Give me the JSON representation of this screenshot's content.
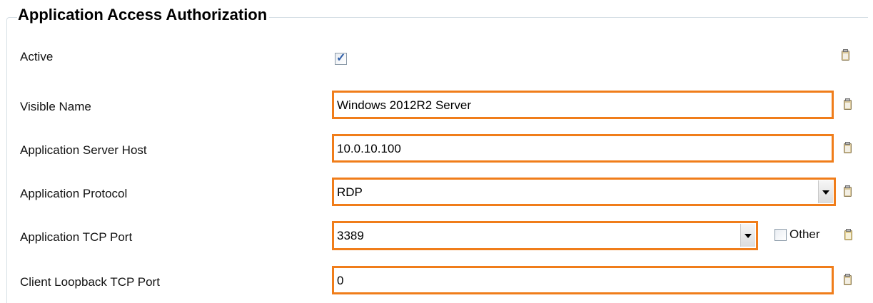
{
  "section": {
    "title": "Application Access Authorization"
  },
  "rows": {
    "active": {
      "label": "Active",
      "checked": true
    },
    "visible_name": {
      "label": "Visible Name",
      "value": "Windows 2012R2 Server"
    },
    "server_host": {
      "label": "Application Server Host",
      "value": "10.0.10.100"
    },
    "protocol": {
      "label": "Application Protocol",
      "value": "RDP"
    },
    "tcp_port": {
      "label": "Application TCP Port",
      "value": "3389",
      "other_label": "Other",
      "other_checked": false
    },
    "loopback_port": {
      "label": "Client Loopback TCP Port",
      "value": "0"
    }
  },
  "colors": {
    "highlight_border": "#f07d1a",
    "group_border": "#d5dfe5"
  },
  "icons": {
    "row_action": "clipboard-icon"
  }
}
